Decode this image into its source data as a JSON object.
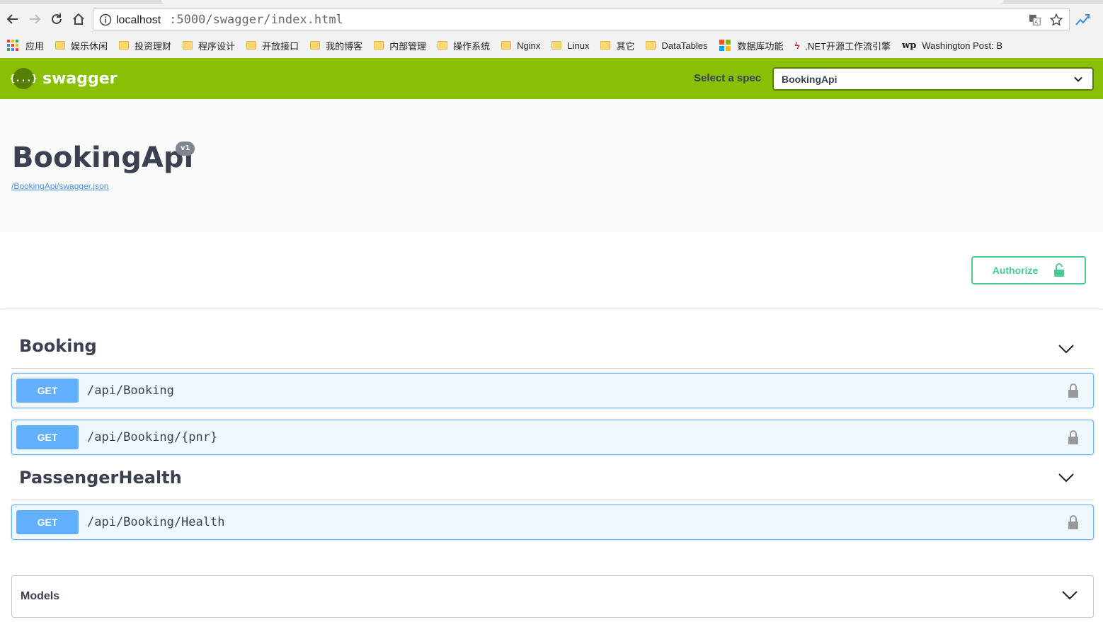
{
  "browser": {
    "url_host": "localhost",
    "url_path": ":5000/swagger/index.html",
    "bookmarks": [
      {
        "label": "应用",
        "type": "apps"
      },
      {
        "label": "娱乐休闲",
        "type": "folder"
      },
      {
        "label": "投资理财",
        "type": "folder"
      },
      {
        "label": "程序设计",
        "type": "folder"
      },
      {
        "label": "开放接口",
        "type": "folder"
      },
      {
        "label": "我的博客",
        "type": "folder"
      },
      {
        "label": "内部管理",
        "type": "folder"
      },
      {
        "label": "操作系统",
        "type": "folder"
      },
      {
        "label": "Nginx",
        "type": "folder"
      },
      {
        "label": "Linux",
        "type": "folder"
      },
      {
        "label": "其它",
        "type": "folder"
      },
      {
        "label": "DataTables",
        "type": "folder"
      },
      {
        "label": "数据库功能",
        "type": "ms"
      },
      {
        "label": ".NET开源工作流引擎",
        "type": "red"
      },
      {
        "label": "Washington Post: B",
        "type": "wp"
      }
    ]
  },
  "topbar": {
    "logo_text": "swagger",
    "logo_glyph": "{...}",
    "spec_label": "Select a spec",
    "spec_selected": "BookingApi"
  },
  "info": {
    "title": "BookingApi",
    "version": "v1",
    "spec_url": "/BookingApi/swagger.json"
  },
  "auth": {
    "authorize_label": "Authorize"
  },
  "tags": [
    {
      "name": "Booking",
      "operations": [
        {
          "method": "GET",
          "path": "/api/Booking"
        },
        {
          "method": "GET",
          "path": "/api/Booking/{pnr}"
        }
      ]
    },
    {
      "name": "PassengerHealth",
      "operations": [
        {
          "method": "GET",
          "path": "/api/Booking/Health"
        }
      ]
    }
  ],
  "models": {
    "title": "Models"
  },
  "colors": {
    "topbar": "#89bf04",
    "get_method": "#61affe",
    "authorize": "#49cc90",
    "text": "#3b4151"
  }
}
